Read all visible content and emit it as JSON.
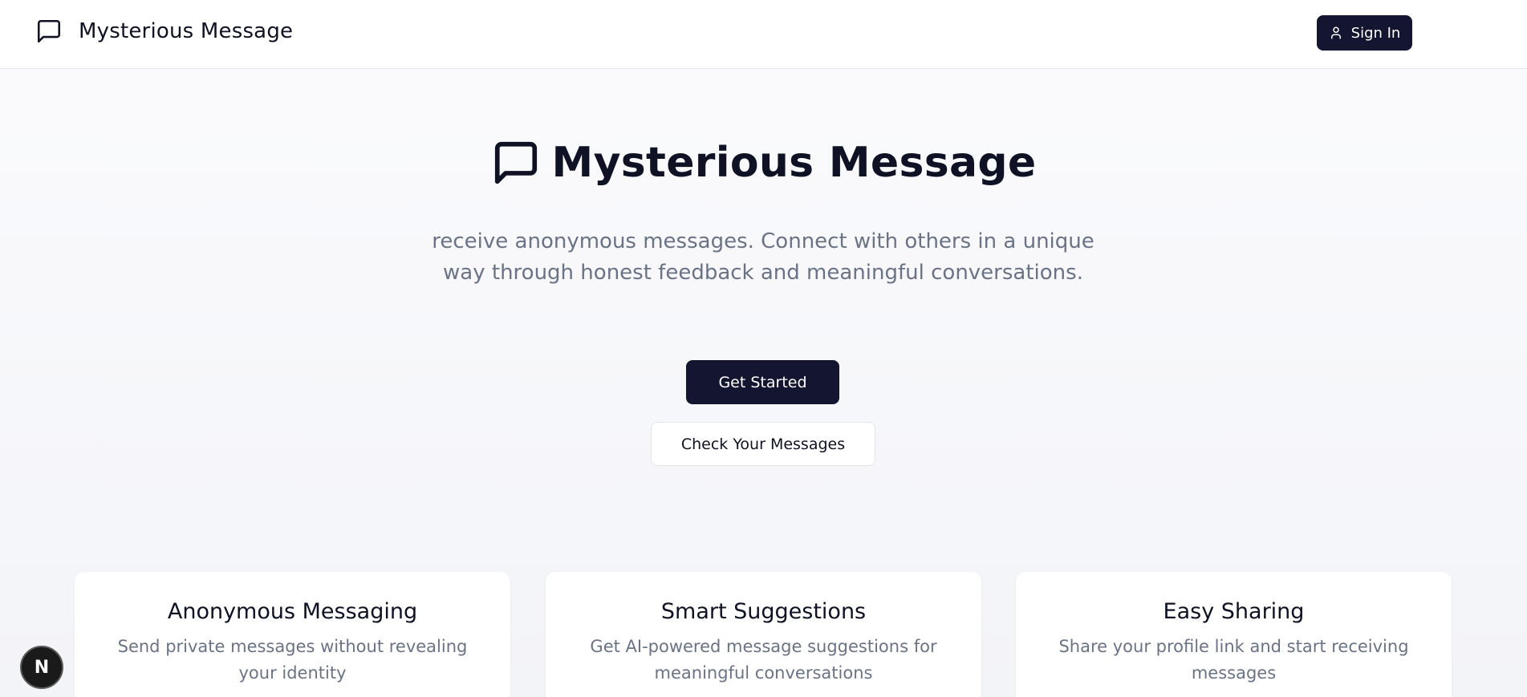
{
  "header": {
    "brand_name": "Mysterious Message",
    "signin_label": "Sign In"
  },
  "hero": {
    "title": "Mysterious Message",
    "subtitle": "receive anonymous messages. Connect with others in a unique way through honest feedback and meaningful conversations.",
    "primary_button": "Get Started",
    "secondary_button": "Check Your Messages"
  },
  "features": [
    {
      "title": "Anonymous Messaging",
      "description": "Send private messages without revealing your identity"
    },
    {
      "title": "Smart Suggestions",
      "description": "Get AI-powered message suggestions for meaningful conversations"
    },
    {
      "title": "Easy Sharing",
      "description": "Share your profile link and start receiving messages"
    }
  ],
  "dev_badge": {
    "label": "N"
  },
  "icons": {
    "brand": "message-square-icon",
    "signin": "user-icon",
    "hero": "message-square-icon"
  },
  "colors": {
    "primary": "#141530",
    "text": "#0f1124",
    "muted": "#6a7386"
  }
}
